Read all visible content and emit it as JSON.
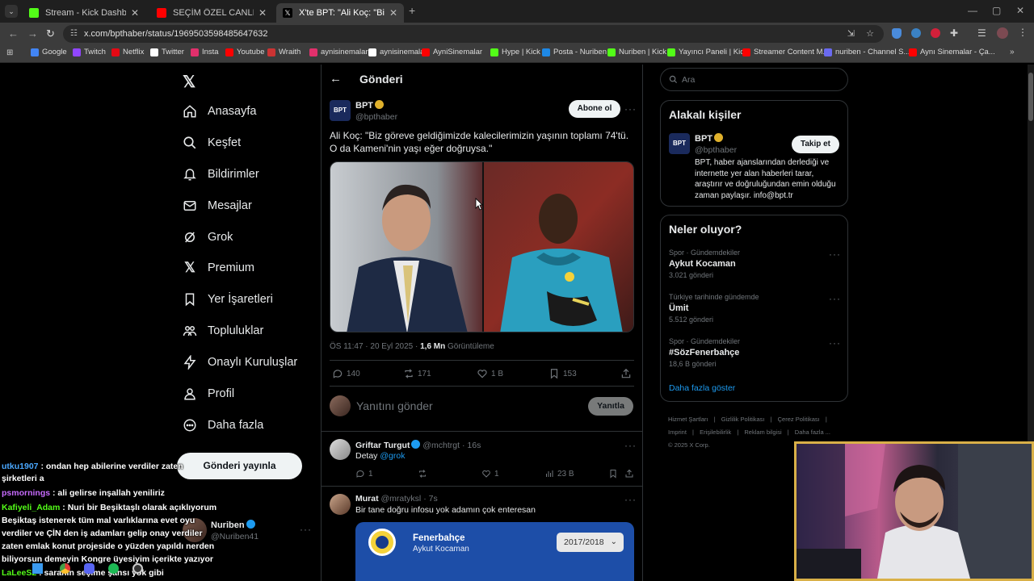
{
  "browser": {
    "tabs": [
      {
        "label": "Stream - Kick Dashboard",
        "icon": "kick-icon",
        "color": "#53fc18"
      },
      {
        "label": "SEÇİM ÖZEL CANLI | Kulübü",
        "icon": "youtube-icon",
        "color": "#ff0000"
      },
      {
        "label": "X'te BPT: \"Ali Koç: \"Biz göreve g",
        "icon": "x-icon",
        "color": "#ffffff"
      }
    ],
    "url": "x.com/bpthaber/status/1969503598485647632",
    "bookmarks": [
      "Google",
      "Twitch",
      "Netflix",
      "Twitter",
      "Insta",
      "Youtube",
      "Wraith",
      "aynisinemalar",
      "aynisinemalar",
      "AyniSinemalar",
      "Hype | Kick",
      "Posta - Nuriben",
      "Nuriben | Kick",
      "Yayıncı Paneli | Kick",
      "Streamer Content M...",
      "nuriben - Channel S...",
      "Aynı Sinemalar - Ça..."
    ]
  },
  "sidebar": {
    "items": [
      "Anasayfa",
      "Keşfet",
      "Bildirimler",
      "Mesajlar",
      "Grok",
      "Premium",
      "Yer İşaretleri",
      "Topluluklar",
      "Onaylı Kuruluşlar",
      "Profil",
      "Daha fazla"
    ],
    "post_button": "Gönderi yayınla",
    "account": {
      "name": "Nuriben",
      "handle": "@Nuriben41"
    }
  },
  "main": {
    "header": "Gönderi",
    "post": {
      "author": "BPT",
      "handle": "@bpthaber",
      "follow": "Abone ol",
      "text": "Ali Koç: \"Biz göreve geldiğimizde kalecilerimizin yaşının toplamı 74'tü. O da Kameni'nin yaşı eğer doğruysa.\"",
      "time": "ÖS 11:47 · 20 Eyl 2025 · ",
      "views": "1,6 Mn",
      "views_label": " Görüntüleme",
      "replies": "140",
      "reposts": "171",
      "likes": "1 B",
      "bookmarks": "153"
    },
    "reply_placeholder": "Yanıtını gönder",
    "reply_button": "Yanıtla",
    "replies": [
      {
        "name": "Griftar Turgut",
        "handle": "@mchtrgt",
        "time": "· 16s",
        "text": "Detay ",
        "mention": "@grok",
        "replies": "1",
        "likes": "1",
        "views": "23 B"
      },
      {
        "name": "Murat",
        "handle": "@mratyksl",
        "time": "· 7s",
        "text": "Bir tane doğru infosu yok adamın çok enteresan",
        "embed_title": "Fenerbahçe",
        "embed_sub": "Aykut Kocaman",
        "embed_select": "2017/2018"
      }
    ]
  },
  "right": {
    "search_placeholder": "Ara",
    "people_title": "Alakalı kişiler",
    "person": {
      "name": "BPT",
      "handle": "@bpthaber",
      "follow": "Takip et",
      "bio": "BPT, haber ajanslarından derlediği ve internette yer alan haberleri tarar, araştırır ve doğruluğundan emin olduğu zaman paylaşır. info@bpt.tr"
    },
    "trends_title": "Neler oluyor?",
    "trends": [
      {
        "category": "Spor · Gündemdekiler",
        "name": "Aykut Kocaman",
        "count": "3.021 gönderi"
      },
      {
        "category": "Türkiye tarihinde gündemde",
        "name": "Ümit",
        "count": "5.512 gönderi"
      },
      {
        "category": "Spor · Gündemdekiler",
        "name": "#SözFenerbahçe",
        "count": "18,6 B gönderi"
      }
    ],
    "show_more": "Daha fazla göster",
    "footer": [
      "Hizmet Şartları",
      "Gizlilik Politikası",
      "Çerez Politikası",
      "Imprint",
      "Erişilebilirlik",
      "Reklam bilgisi",
      "Daha fazla ...",
      "© 2025 X Corp."
    ]
  },
  "chat": [
    {
      "user": "utku1907",
      "color": "#4aa8ff",
      "text": " : ondan hep abilerine verdiler zaten"
    },
    {
      "user": "",
      "color": "#ffffff",
      "text": "şirketleri a"
    },
    {
      "user": "psmornings",
      "color": "#c86bff",
      "text": " : ali gelirse inşallah yeniliriz"
    },
    {
      "user": "Kafiyeli_Adam",
      "color": "#53fc18",
      "text": " : Nuri bir Beşiktaşlı olarak açıklıyorum"
    },
    {
      "user": "",
      "color": "#ffffff",
      "text": "Beşiktaş istenerek tüm mal varlıklarına evet oyu"
    },
    {
      "user": "",
      "color": "#ffffff",
      "text": "verdiler ve ÇİN den iş adamları gelip onay verdiler"
    },
    {
      "user": "",
      "color": "#ffffff",
      "text": "zaten emlak konut projeside o yüzden yapıldı nerden"
    },
    {
      "user": "",
      "color": "#ffffff",
      "text": "biliyorsun demeyin Kongre üyesiyim içerikte yazıyor"
    },
    {
      "user": "LaLeeS2",
      "color": "#53fc18",
      "text": " : saranın seçime şansı yok gibi"
    }
  ]
}
